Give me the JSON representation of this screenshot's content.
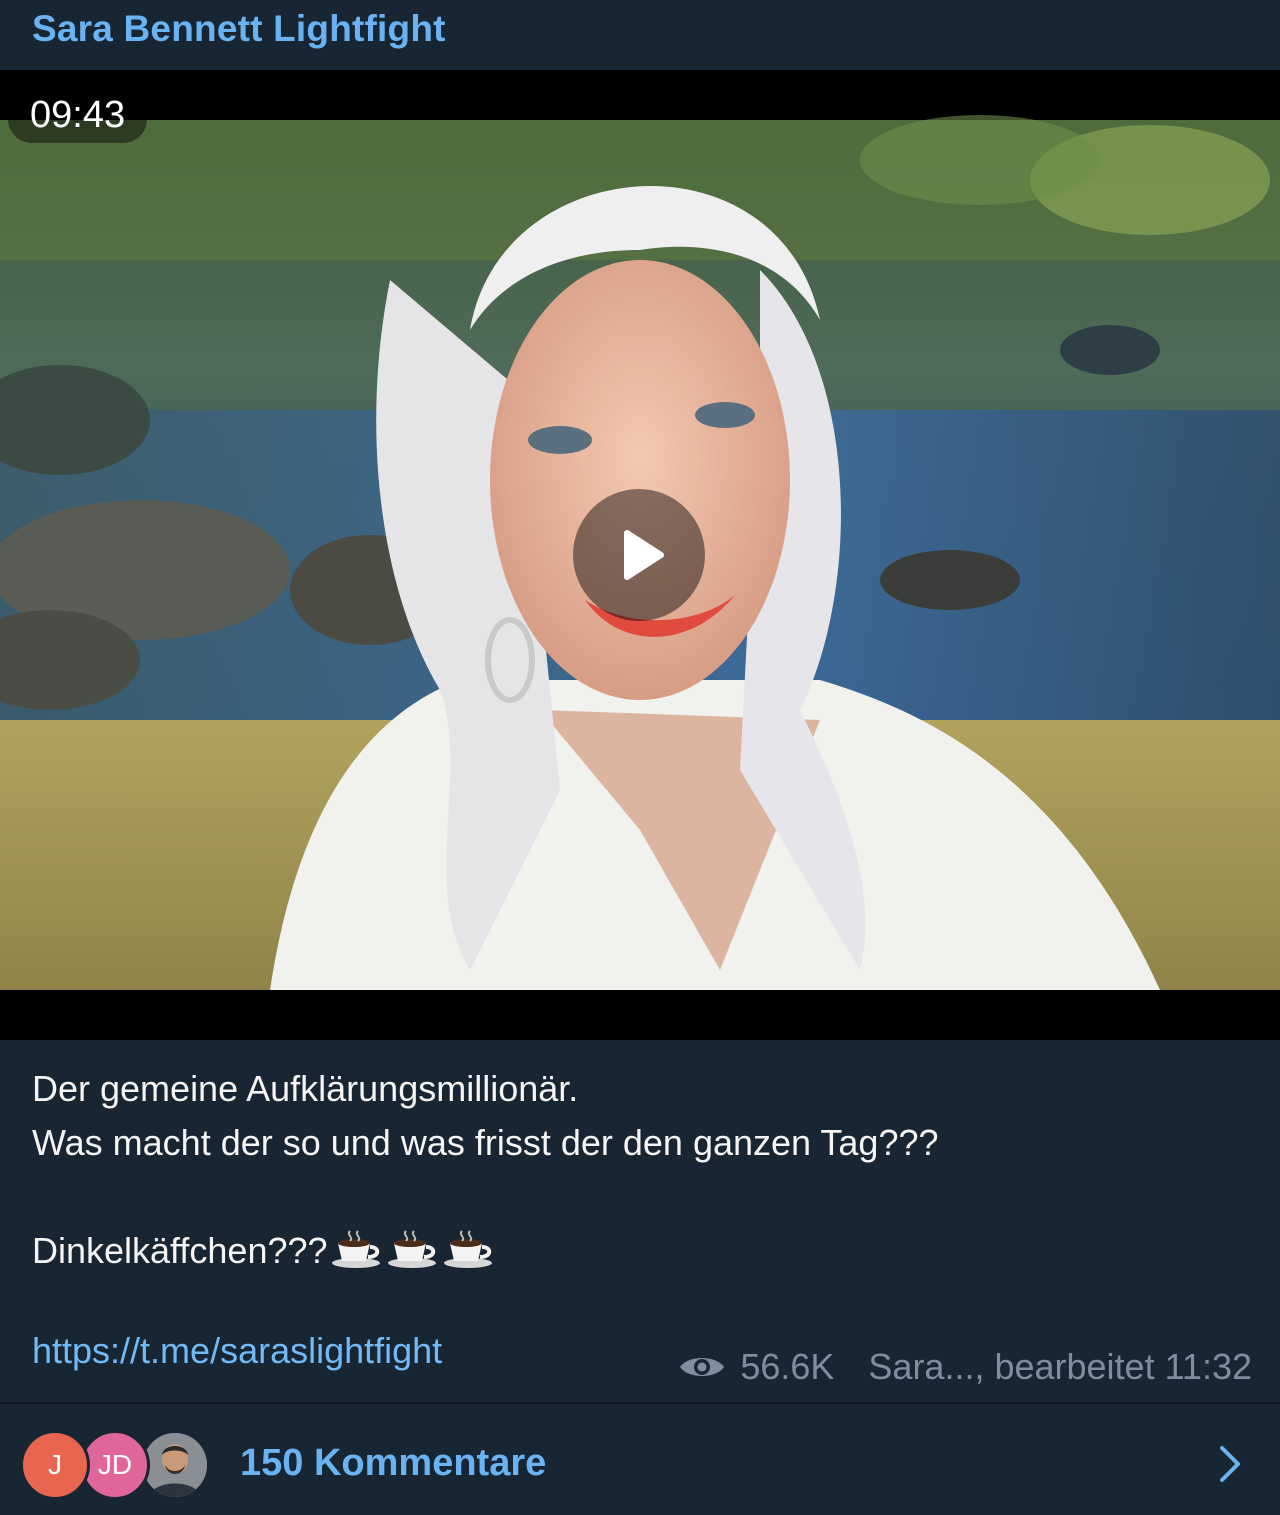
{
  "channel": {
    "name": "Sara Bennett Lightfight"
  },
  "video": {
    "duration": "09:43"
  },
  "caption": {
    "line1": "Der gemeine Aufklärungsmillionär.",
    "line2": "Was macht der so und was frisst der den ganzen Tag???",
    "line3": "Dinkelkäffchen???",
    "emoji": [
      "coffee-cup",
      "coffee-cup",
      "coffee-cup"
    ]
  },
  "link": {
    "text": "https://t.me/saraslightfight"
  },
  "meta": {
    "views": "56.6K",
    "author_edited": "Sara..., bearbeitet 11:32"
  },
  "comments": {
    "label": "150 Kommentare",
    "avatars": [
      {
        "initials": "J",
        "color": "#e8664f"
      },
      {
        "initials": "JD",
        "color": "#e0659a"
      },
      {
        "initials": "",
        "color": "#6b6f74"
      }
    ]
  },
  "colors": {
    "background": "#182533",
    "accent": "#6ab3f3",
    "link": "#71baf7",
    "muted": "#7d8e9e"
  }
}
